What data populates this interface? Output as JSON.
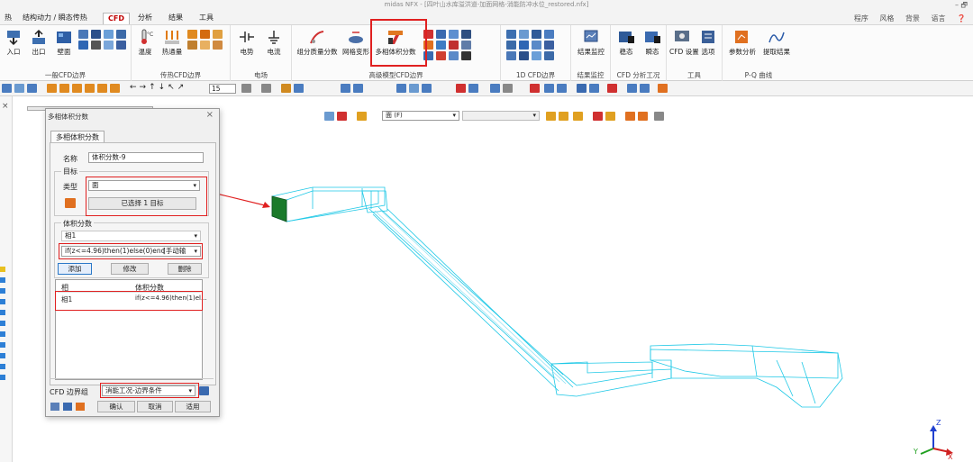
{
  "window": {
    "title": "midas NFX - [四叶山水库溢洪道-加面网格-消能防冲水位_restored.nfx]",
    "controls": "–  🗗"
  },
  "menu": {
    "items": [
      "热",
      "结构动力 / 瞬态传热",
      "CFD",
      "分析",
      "结果",
      "工具"
    ],
    "active_index": 2,
    "right": [
      "程序",
      "风格",
      "背景",
      "语言"
    ]
  },
  "ribbon": {
    "groups": [
      {
        "label": "一般CFD边界",
        "buttons": [
          "入口",
          "出口",
          "壁面"
        ]
      },
      {
        "label": "传热CFD边界",
        "buttons": [
          "温度",
          "热通量"
        ]
      },
      {
        "label": "电场",
        "buttons": [
          "电势",
          "电流"
        ]
      },
      {
        "label": "高级模型CFD边界",
        "buttons": [
          "组分质量分数",
          "网格变形",
          "多相体积分数"
        ]
      },
      {
        "label": "1D CFD边界",
        "buttons": []
      },
      {
        "label": "结果监控",
        "buttons": [
          "结果监控"
        ]
      },
      {
        "label": "CFD 分析工况",
        "buttons": [
          "稳态",
          "瞬态"
        ]
      },
      {
        "label": "工具",
        "buttons": [
          "CFD 设置",
          "选项"
        ]
      },
      {
        "label": "P-Q 曲线",
        "buttons": [
          "参数分析",
          "提取结果"
        ]
      }
    ]
  },
  "toolbar": {
    "zoom_value": "15"
  },
  "viewport": {
    "face_select": "面 (F)"
  },
  "dialog": {
    "title": "多相体积分数",
    "tab": "多相体积分数",
    "name_label": "名称",
    "name_value": "体积分数-9",
    "target_section": "目标",
    "type_label": "类型",
    "type_value": "面",
    "target_button": "已选择 1 目标",
    "volume_section": "体积分数",
    "phase_value": "相1",
    "formula_value": "if(z<=4.96)then(1)else(0)end",
    "formula_mode": "[手动输",
    "add_button": "添加",
    "modify_button": "修改",
    "delete_button": "删除",
    "table_headers": [
      "相",
      "体积分数"
    ],
    "table_rows": [
      {
        "phase": "相1",
        "fraction": "if(z<=4.96)then(1)el..."
      }
    ],
    "bc_group_label": "CFD 边界组",
    "bc_group_value": "消能工况-边界条件",
    "ok_button": "确认",
    "cancel_button": "取消",
    "apply_button": "适用"
  },
  "axes": {
    "z": "Z",
    "y": "Y",
    "x": "X"
  },
  "colors": {
    "accent": "#c00000",
    "highlight": "#e02020",
    "mesh": "#1ec8e6",
    "selected_face": "#1a7a2a"
  }
}
